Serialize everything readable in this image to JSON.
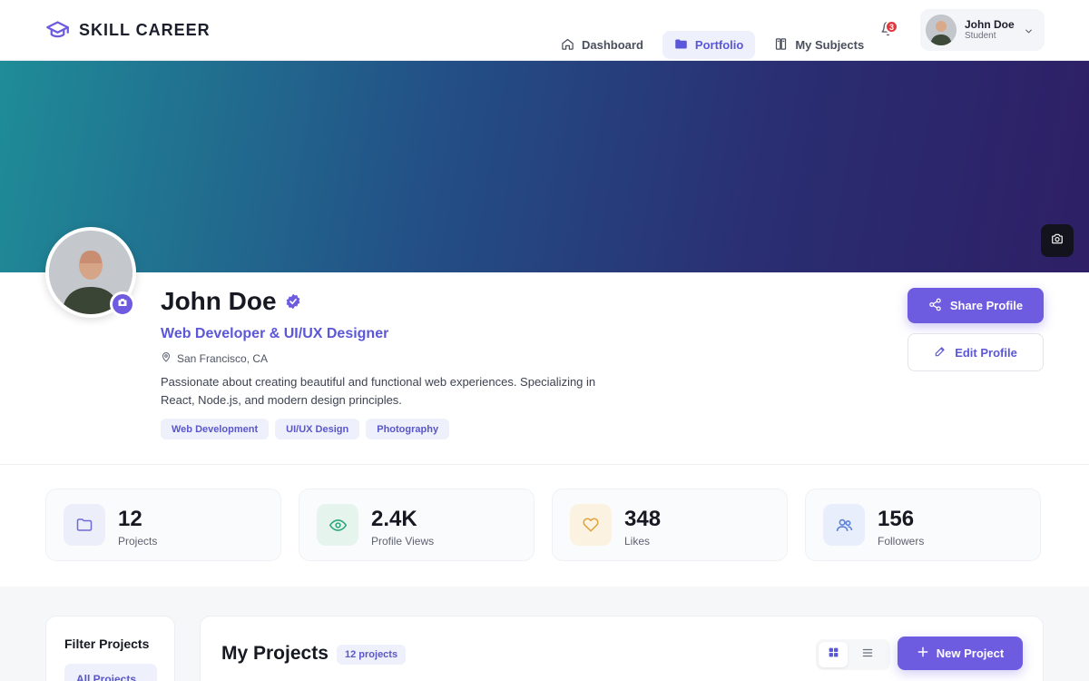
{
  "brand": {
    "name": "SKILL CAREER",
    "icon": "graduation-cap-icon",
    "accent": "#6d5be0"
  },
  "nav": [
    {
      "label": "Dashboard",
      "icon": "home-icon",
      "active": false
    },
    {
      "label": "Portfolio",
      "icon": "folder-icon",
      "active": true
    },
    {
      "label": "My Subjects",
      "icon": "book-icon",
      "active": false
    }
  ],
  "notifications": {
    "count": "3",
    "icon": "bell-icon",
    "badge_color": "#e0383e"
  },
  "user": {
    "name": "John Doe",
    "role": "Student"
  },
  "profile": {
    "name": "John Doe",
    "verified_icon": "verified-badge-icon",
    "title": "Web Developer & UI/UX Designer",
    "location": "San Francisco, CA",
    "bio": "Passionate about creating beautiful and functional web experiences. Specializing in React, Node.js, and modern design principles.",
    "tags": [
      "Web Development",
      "UI/UX Design",
      "Photography"
    ]
  },
  "actions": {
    "share_label": "Share Profile",
    "edit_label": "Edit Profile"
  },
  "stats": [
    {
      "value": "12",
      "label": "Projects",
      "icon": "folder-icon",
      "color": "#6d6ad8",
      "bg": "#eceefa"
    },
    {
      "value": "2.4K",
      "label": "Profile Views",
      "icon": "eye-icon",
      "color": "#2ea57a",
      "bg": "#e5f5ee"
    },
    {
      "value": "348",
      "label": "Likes",
      "icon": "heart-icon",
      "color": "#e2a23a",
      "bg": "#fcf2e2"
    },
    {
      "value": "156",
      "label": "Followers",
      "icon": "users-icon",
      "color": "#5a7fd6",
      "bg": "#e8eefb"
    }
  ],
  "filters": {
    "title": "Filter Projects",
    "active": "All Projects"
  },
  "projects": {
    "title": "My Projects",
    "count_label": "12 projects",
    "new_label": "New Project",
    "view_mode": "grid"
  }
}
